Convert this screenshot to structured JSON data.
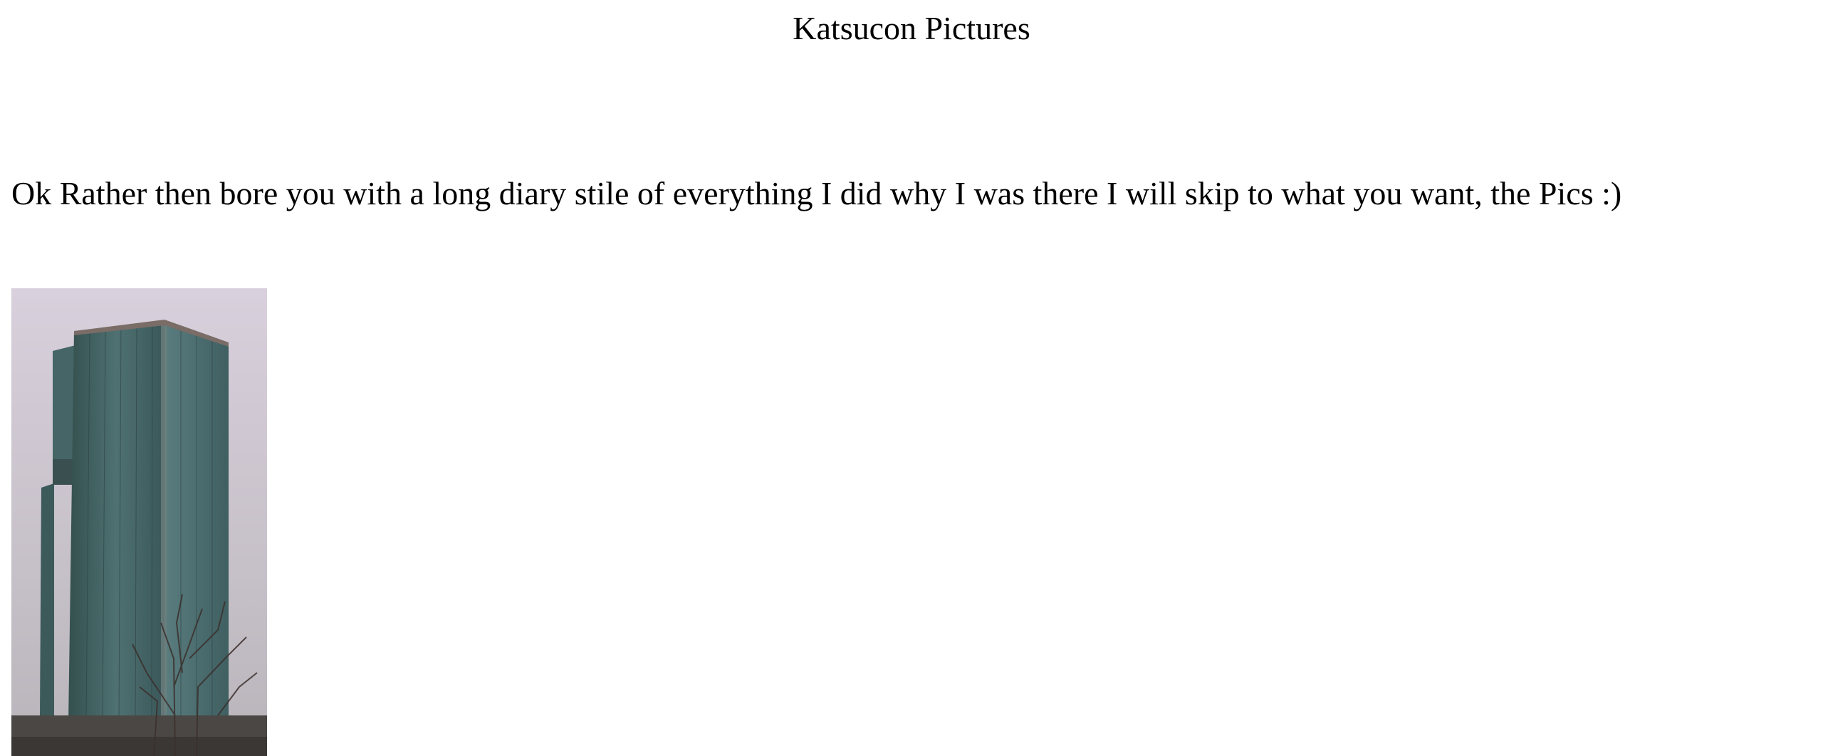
{
  "page": {
    "title": "Katsucon Pictures",
    "intro": "Ok Rather then bore you with a long diary stile of everything I did why I was there I will skip to what you want, the Pics :)"
  },
  "photo": {
    "subject": "tower-building"
  },
  "colors": {
    "background": "#ffffff",
    "text": "#000000",
    "sky": "#c9c2cc",
    "glass": "#4a6a6c",
    "glass_dark": "#2f4a4e"
  }
}
